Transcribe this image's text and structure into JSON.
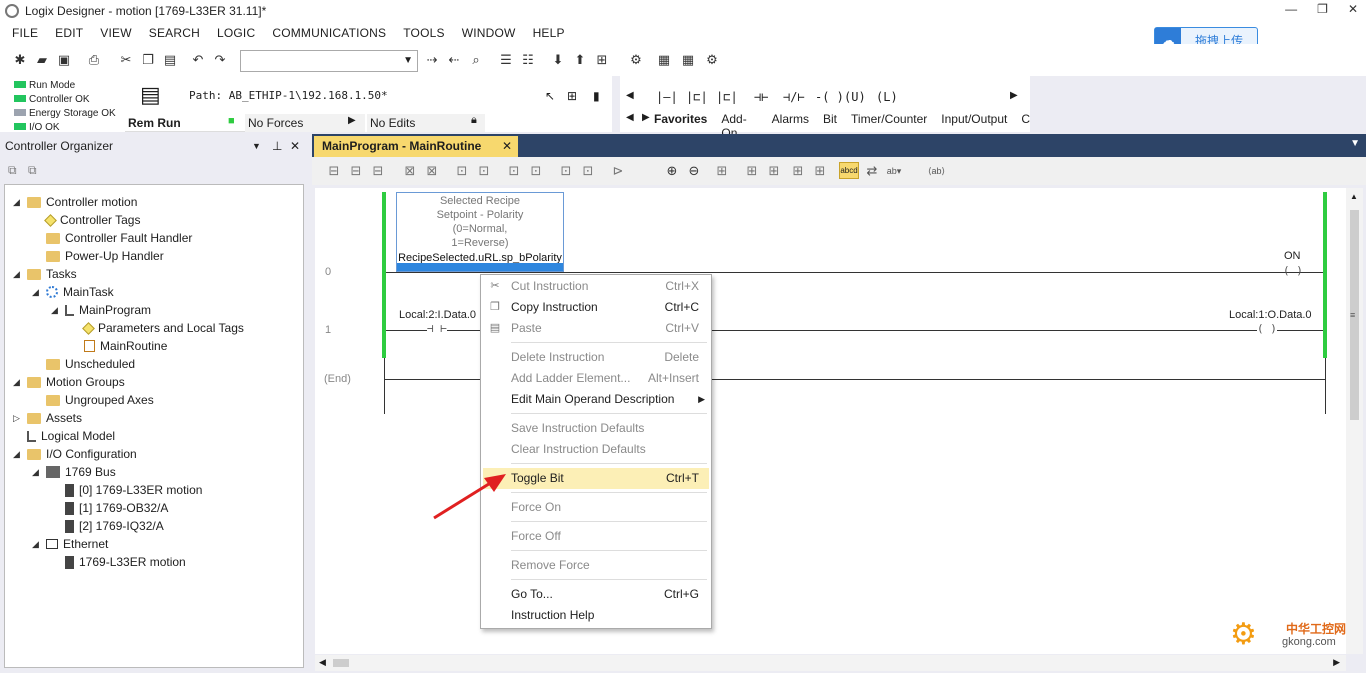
{
  "window": {
    "title": "Logix Designer - motion [1769-L33ER 31.11]*",
    "minimize": "—",
    "restore": "❐",
    "close": "✕"
  },
  "menu": [
    "FILE",
    "EDIT",
    "VIEW",
    "SEARCH",
    "LOGIC",
    "COMMUNICATIONS",
    "TOOLS",
    "WINDOW",
    "HELP"
  ],
  "cloud_button": {
    "label": "拖拽上传",
    "icon": "cloud-icon"
  },
  "toolbar": {
    "combo_value": ""
  },
  "status": {
    "leds": [
      {
        "label": "Run Mode",
        "color": "#22c55e"
      },
      {
        "label": "Controller OK",
        "color": "#22c55e"
      },
      {
        "label": "Energy Storage OK",
        "color": "#9ca3af"
      },
      {
        "label": "I/O OK",
        "color": "#22c55e"
      }
    ],
    "path": "Path: AB_ETHIP-1\\192.168.1.50*",
    "mode": "Rem Run",
    "forces": "No Forces",
    "edits": "No Edits"
  },
  "palette": {
    "tabs": [
      "Favorites",
      "Add-On",
      "Alarms",
      "Bit",
      "Timer/Counter",
      "Input/Output",
      "C"
    ],
    "selected_tab": "Favorites"
  },
  "organizer": {
    "title": "Controller Organizer",
    "tree": [
      {
        "label": "Controller motion",
        "icon": "folder-icon",
        "level": 0,
        "expand": "◢"
      },
      {
        "label": "Controller Tags",
        "icon": "tag-icon",
        "level": 1,
        "expand": ""
      },
      {
        "label": "Controller Fault Handler",
        "icon": "folder-icon",
        "level": 1,
        "expand": ""
      },
      {
        "label": "Power-Up Handler",
        "icon": "folder-icon",
        "level": 1,
        "expand": ""
      },
      {
        "label": "Tasks",
        "icon": "folder-icon",
        "level": 0,
        "expand": "◢"
      },
      {
        "label": "MainTask",
        "icon": "task-icon",
        "level": 1,
        "expand": "◢"
      },
      {
        "label": "MainProgram",
        "icon": "program-icon",
        "level": 2,
        "expand": "◢"
      },
      {
        "label": "Parameters and Local Tags",
        "icon": "tag-icon",
        "level": 3,
        "expand": ""
      },
      {
        "label": "MainRoutine",
        "icon": "routine-icon",
        "level": 3,
        "expand": ""
      },
      {
        "label": "Unscheduled",
        "icon": "folder-icon",
        "level": 1,
        "expand": ""
      },
      {
        "label": "Motion Groups",
        "icon": "folder-icon",
        "level": 0,
        "expand": "◢"
      },
      {
        "label": "Ungrouped Axes",
        "icon": "folder-icon",
        "level": 1,
        "expand": ""
      },
      {
        "label": "Assets",
        "icon": "folder-icon",
        "level": 0,
        "expand": "▷"
      },
      {
        "label": "Logical Model",
        "icon": "logical-model-icon",
        "level": 0,
        "expand": ""
      },
      {
        "label": "I/O Configuration",
        "icon": "folder-icon",
        "level": 0,
        "expand": "◢"
      },
      {
        "label": "1769 Bus",
        "icon": "rack-icon",
        "level": 1,
        "expand": "◢"
      },
      {
        "label": "[0] 1769-L33ER motion",
        "icon": "module-icon",
        "level": 2,
        "expand": ""
      },
      {
        "label": "[1] 1769-OB32/A",
        "icon": "module-icon",
        "level": 2,
        "expand": ""
      },
      {
        "label": "[2] 1769-IQ32/A",
        "icon": "module-icon",
        "level": 2,
        "expand": ""
      },
      {
        "label": "Ethernet",
        "icon": "network-icon",
        "level": 1,
        "expand": "◢"
      },
      {
        "label": "1769-L33ER motion",
        "icon": "module-icon",
        "level": 2,
        "expand": ""
      }
    ]
  },
  "document": {
    "tab_label": "MainProgram - MainRoutine",
    "tab_close": "✕",
    "rungs": [
      {
        "number": "0"
      },
      {
        "number": "1"
      },
      {
        "number": "(End)"
      }
    ],
    "instruction": {
      "description_lines": [
        "Selected Recipe",
        "Setpoint - Polarity",
        "(0=Normal,",
        "1=Reverse)"
      ],
      "operand": "RecipeSelected.uRL.sp_bPolarity"
    },
    "rung0_output": "ON",
    "rung1_input": "Local:2:I.Data.0",
    "rung1_output": "Local:1:O.Data.0",
    "abcd_label": "abcd"
  },
  "context_menu": [
    {
      "label": "Cut Instruction",
      "shortcut": "Ctrl+X",
      "enabled": false,
      "icon": "cut-icon"
    },
    {
      "label": "Copy Instruction",
      "shortcut": "Ctrl+C",
      "enabled": true,
      "icon": "copy-icon"
    },
    {
      "label": "Paste",
      "shortcut": "Ctrl+V",
      "enabled": false,
      "icon": "paste-icon"
    },
    {
      "label": "Delete Instruction",
      "shortcut": "Delete",
      "enabled": false
    },
    {
      "label": "Add Ladder Element...",
      "shortcut": "Alt+Insert",
      "enabled": false
    },
    {
      "label": "Edit Main Operand Description",
      "shortcut": "",
      "enabled": true,
      "submenu": true
    },
    {
      "label": "Save Instruction Defaults",
      "shortcut": "",
      "enabled": false
    },
    {
      "label": "Clear Instruction Defaults",
      "shortcut": "",
      "enabled": false
    },
    {
      "label": "Toggle Bit",
      "shortcut": "Ctrl+T",
      "enabled": true,
      "highlighted": true
    },
    {
      "label": "Force On",
      "shortcut": "",
      "enabled": false
    },
    {
      "label": "Force Off",
      "shortcut": "",
      "enabled": false
    },
    {
      "label": "Remove Force",
      "shortcut": "",
      "enabled": false
    },
    {
      "label": "Go To...",
      "shortcut": "Ctrl+G",
      "enabled": true
    },
    {
      "label": "Instruction Help",
      "shortcut": "",
      "enabled": true
    }
  ],
  "watermark": {
    "line1": "中华工控网",
    "line2": "gkong.com"
  },
  "colors": {
    "accent": "#2e86de",
    "tab_active": "#f7d86e",
    "tab_bar": "#2d4467",
    "rail_green": "#2ecc40",
    "highlight": "#fcefb6",
    "arrow": "#e02020"
  }
}
